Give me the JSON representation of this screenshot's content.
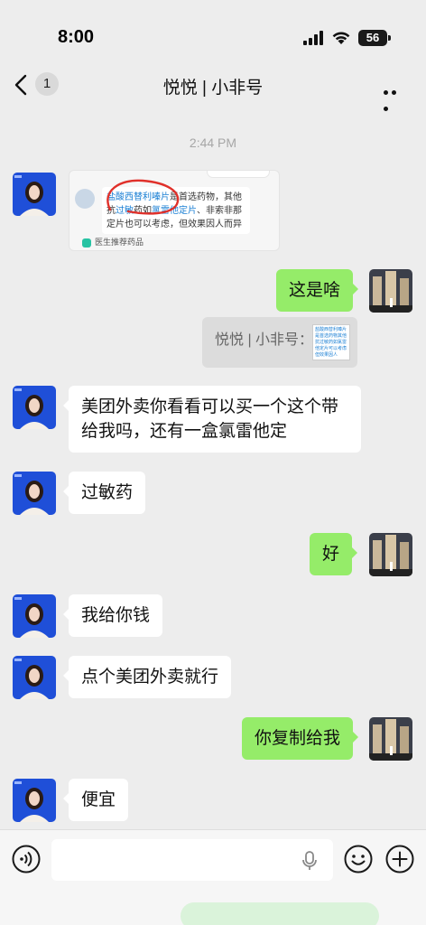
{
  "status_bar": {
    "time": "8:00",
    "battery": "56"
  },
  "header": {
    "back_badge": "1",
    "title": "悦悦 | 小非号"
  },
  "timestamp": "2:44 PM",
  "image_message": {
    "drug_highlight": "盐酸西替利嗪片",
    "line1_rest": "是首选药物，其他",
    "line2_a": "抗",
    "line2_hl": "过敏",
    "line2_b": "药如",
    "line2_hl2": "氯雷他定片",
    "line2_c": "、非索非那",
    "line3": "定片也可以考虑，但效果因人而异",
    "footer": "医生推荐药品"
  },
  "messages": [
    {
      "id": "m1",
      "side": "right",
      "text": "这是啥"
    },
    {
      "id": "m2",
      "side": "left",
      "text": "美团外卖你看看可以买一个这个带给我吗，还有一盒氯雷他定"
    },
    {
      "id": "m3",
      "side": "left",
      "text": "过敏药"
    },
    {
      "id": "m4",
      "side": "right",
      "text": "好"
    },
    {
      "id": "m5",
      "side": "left",
      "text": "我给你钱"
    },
    {
      "id": "m6",
      "side": "left",
      "text": "点个美团外卖就行"
    },
    {
      "id": "m7",
      "side": "right",
      "text": "你复制给我"
    },
    {
      "id": "m8",
      "side": "left",
      "text": "便宜"
    }
  ],
  "quote": {
    "text": "悦悦 | 小非号：",
    "thumb_text": "盐酸西替利嗪片是首选药物其他抗过敏药如氯雷他定片可以考虑但效果因人"
  },
  "input": {
    "value": ""
  },
  "colors": {
    "background": "#ededed",
    "green_bubble": "#95ec69",
    "white_bubble": "#ffffff",
    "highlight_circle": "#e0302a"
  },
  "icons": [
    "back-chevron-icon",
    "more-icon",
    "voice-icon",
    "mic-icon",
    "emoji-icon",
    "plus-icon"
  ]
}
